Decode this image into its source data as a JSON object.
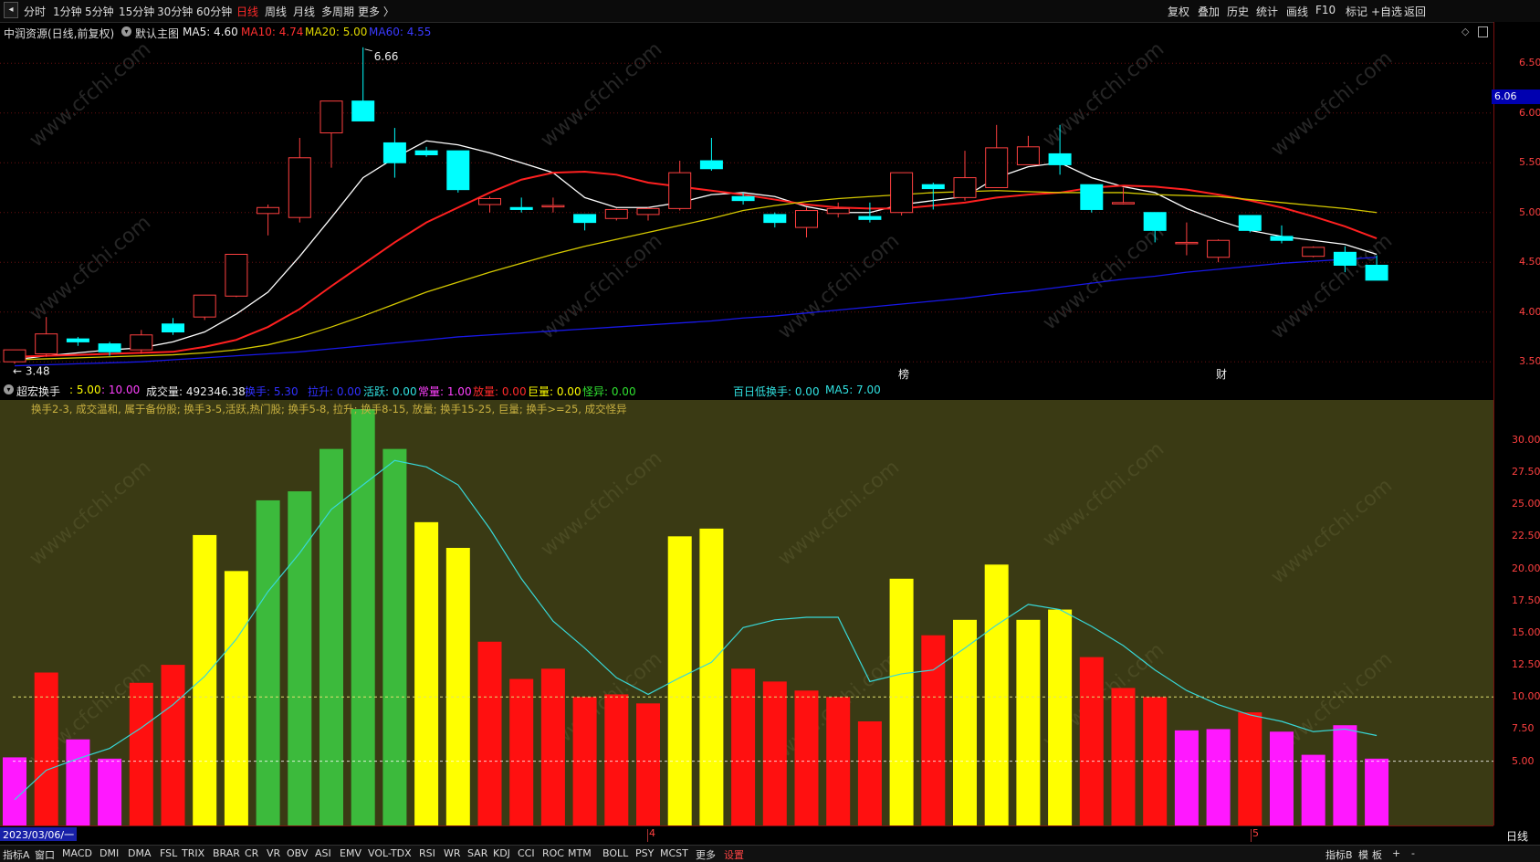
{
  "toolbar": {
    "nav_back_icon": "arrow-left-icon",
    "periods": [
      "分时",
      "1分钟",
      "5分钟",
      "15分钟",
      "30分钟",
      "60分钟",
      "日线",
      "周线",
      "月线",
      "多周期",
      "更多 〉"
    ],
    "active_period": "日线",
    "right_items": [
      "复权",
      "叠加",
      "历史",
      "统计",
      "画线",
      "F10",
      "标记",
      "+自选",
      "返回"
    ]
  },
  "main_chart": {
    "stock_title": "中润资源(日线,前复权)",
    "indicator_name": "默认主图",
    "ma5": "MA5: 4.60",
    "ma10": "MA10: 4.74",
    "ma20": "MA20: 5.00",
    "ma60": "MA60: 4.55",
    "high_label": "6.66",
    "low_label": "3.48",
    "price_tag": "6.06",
    "event_markers": [
      "榜",
      "财"
    ],
    "y_ticks": [
      "6.50",
      "6.00",
      "5.50",
      "5.00",
      "4.50",
      "4.00",
      "3.50"
    ]
  },
  "sub_chart": {
    "name": "超宏换手",
    "v1": ": 5.00",
    "v2": ": 10.00",
    "volume": "成交量: 492346.38",
    "l_huanshou": "换手: 5.30",
    "l_lasheng": "拉升: 0.00",
    "l_huoyue": "活跃: 0.00",
    "l_changliang": "常量: 1.00",
    "l_fangliang": "放量: 0.00",
    "l_juliang": "巨量: 0.00",
    "l_guaiyi": "怪异: 0.00",
    "l_dihuan": "百日低换手: 0.00",
    "l_ma5": "MA5: 7.00",
    "note": "换手2-3, 成交温和, 属于备份股; 换手3-5,活跃,热门股; 换手5-8, 拉升; 换手8-15, 放量; 换手15-25, 巨量; 换手>=25, 成交怪异",
    "y_ticks": [
      "30.00",
      "27.50",
      "25.00",
      "22.50",
      "20.00",
      "17.50",
      "15.00",
      "12.50",
      "10.00",
      "7.50",
      "5.00"
    ]
  },
  "x_axis": {
    "start_date": "2023/03/06/一",
    "month_labels": [
      "4",
      "5"
    ],
    "period_label": "日线"
  },
  "bottom_tabs": {
    "left": [
      "指标A",
      "窗口",
      "MACD",
      "DMI",
      "DMA",
      "FSL",
      "TRIX",
      "BRAR",
      "CR",
      "VR",
      "OBV",
      "ASI",
      "EMV",
      "VOL-TDX",
      "RSI",
      "WR",
      "SAR",
      "KDJ",
      "CCI",
      "ROC",
      "MTM",
      "BOLL",
      "PSY",
      "MCST",
      "更多",
      "设置"
    ],
    "right": [
      "指标B",
      "模",
      "板",
      "+",
      "-"
    ]
  },
  "watermark": "www.cfchi.com",
  "chart_data": [
    {
      "type": "candlestick",
      "title": "中润资源(日线,前复权)",
      "ylim": [
        3.3,
        6.75
      ],
      "candles": [
        {
          "o": 3.5,
          "c": 3.62,
          "h": 3.62,
          "l": 3.48
        },
        {
          "o": 3.58,
          "c": 3.78,
          "h": 3.95,
          "l": 3.55
        },
        {
          "o": 3.73,
          "c": 3.7,
          "h": 3.75,
          "l": 3.66
        },
        {
          "o": 3.68,
          "c": 3.6,
          "h": 3.7,
          "l": 3.56
        },
        {
          "o": 3.62,
          "c": 3.77,
          "h": 3.82,
          "l": 3.58
        },
        {
          "o": 3.88,
          "c": 3.8,
          "h": 3.94,
          "l": 3.77
        },
        {
          "o": 3.95,
          "c": 4.17,
          "h": 4.17,
          "l": 3.92
        },
        {
          "o": 4.16,
          "c": 4.58,
          "h": 4.58,
          "l": 4.15
        },
        {
          "o": 4.99,
          "c": 5.05,
          "h": 5.08,
          "l": 4.77
        },
        {
          "o": 4.95,
          "c": 5.55,
          "h": 5.75,
          "l": 4.9
        },
        {
          "o": 5.8,
          "c": 6.12,
          "h": 6.12,
          "l": 5.45
        },
        {
          "o": 6.12,
          "c": 5.92,
          "h": 6.66,
          "l": 5.92
        },
        {
          "o": 5.7,
          "c": 5.5,
          "h": 5.85,
          "l": 5.35
        },
        {
          "o": 5.62,
          "c": 5.58,
          "h": 5.66,
          "l": 5.56
        },
        {
          "o": 5.62,
          "c": 5.23,
          "h": 5.62,
          "l": 5.2
        },
        {
          "o": 5.08,
          "c": 5.14,
          "h": 5.16,
          "l": 5.0
        },
        {
          "o": 5.05,
          "c": 5.03,
          "h": 5.15,
          "l": 5.0
        },
        {
          "o": 5.07,
          "c": 5.07,
          "h": 5.15,
          "l": 5.0
        },
        {
          "o": 4.98,
          "c": 4.9,
          "h": 4.98,
          "l": 4.82
        },
        {
          "o": 4.94,
          "c": 5.03,
          "h": 5.04,
          "l": 4.92
        },
        {
          "o": 4.98,
          "c": 5.04,
          "h": 5.05,
          "l": 4.92
        },
        {
          "o": 5.04,
          "c": 5.4,
          "h": 5.52,
          "l": 5.02
        },
        {
          "o": 5.52,
          "c": 5.44,
          "h": 5.75,
          "l": 5.42
        },
        {
          "o": 5.16,
          "c": 5.12,
          "h": 5.2,
          "l": 5.08
        },
        {
          "o": 4.98,
          "c": 4.9,
          "h": 5.0,
          "l": 4.85
        },
        {
          "o": 4.85,
          "c": 5.02,
          "h": 5.05,
          "l": 4.75
        },
        {
          "o": 4.99,
          "c": 5.04,
          "h": 5.1,
          "l": 4.95
        },
        {
          "o": 4.96,
          "c": 4.93,
          "h": 5.1,
          "l": 4.9
        },
        {
          "o": 5.0,
          "c": 5.4,
          "h": 5.4,
          "l": 4.97
        },
        {
          "o": 5.28,
          "c": 5.24,
          "h": 5.3,
          "l": 5.03
        },
        {
          "o": 5.15,
          "c": 5.35,
          "h": 5.62,
          "l": 5.12
        },
        {
          "o": 5.25,
          "c": 5.65,
          "h": 5.88,
          "l": 5.25
        },
        {
          "o": 5.48,
          "c": 5.66,
          "h": 5.77,
          "l": 5.48
        },
        {
          "o": 5.59,
          "c": 5.48,
          "h": 5.88,
          "l": 5.38
        },
        {
          "o": 5.28,
          "c": 5.03,
          "h": 5.28,
          "l": 5.0
        },
        {
          "o": 5.1,
          "c": 5.1,
          "h": 5.25,
          "l": 5.08
        },
        {
          "o": 5.0,
          "c": 4.82,
          "h": 5.0,
          "l": 4.7
        },
        {
          "o": 4.7,
          "c": 4.7,
          "h": 4.9,
          "l": 4.57
        },
        {
          "o": 4.55,
          "c": 4.72,
          "h": 4.73,
          "l": 4.5
        },
        {
          "o": 4.97,
          "c": 4.82,
          "h": 4.97,
          "l": 4.8
        },
        {
          "o": 4.76,
          "c": 4.72,
          "h": 4.87,
          "l": 4.69
        },
        {
          "o": 4.56,
          "c": 4.65,
          "h": 4.66,
          "l": 4.55
        },
        {
          "o": 4.6,
          "c": 4.47,
          "h": 4.66,
          "l": 4.4
        },
        {
          "o": 4.47,
          "c": 4.32,
          "h": 4.57,
          "l": 4.32
        }
      ],
      "series": [
        {
          "name": "MA5",
          "color": "#ffffff",
          "values": [
            3.52,
            3.56,
            3.59,
            3.62,
            3.64,
            3.7,
            3.8,
            3.98,
            4.2,
            4.56,
            4.95,
            5.35,
            5.55,
            5.72,
            5.68,
            5.6,
            5.5,
            5.4,
            5.15,
            5.05,
            5.05,
            5.1,
            5.18,
            5.2,
            5.16,
            5.06,
            5.0,
            5.0,
            5.08,
            5.12,
            5.16,
            5.35,
            5.46,
            5.5,
            5.35,
            5.26,
            5.2,
            5.04,
            4.92,
            4.82,
            4.76,
            4.72,
            4.68,
            4.58
          ]
        },
        {
          "name": "MA10",
          "color": "#ff2020",
          "values": [
            3.55,
            3.56,
            3.57,
            3.58,
            3.59,
            3.6,
            3.65,
            3.72,
            3.85,
            4.03,
            4.26,
            4.48,
            4.7,
            4.9,
            5.05,
            5.2,
            5.33,
            5.4,
            5.41,
            5.38,
            5.3,
            5.26,
            5.22,
            5.18,
            5.13,
            5.08,
            5.05,
            5.04,
            5.04,
            5.07,
            5.1,
            5.15,
            5.18,
            5.2,
            5.25,
            5.27,
            5.26,
            5.23,
            5.18,
            5.12,
            5.05,
            4.96,
            4.86,
            4.74
          ]
        },
        {
          "name": "MA20",
          "color": "#d4c800",
          "values": [
            3.52,
            3.53,
            3.54,
            3.55,
            3.56,
            3.57,
            3.59,
            3.62,
            3.67,
            3.75,
            3.85,
            3.96,
            4.08,
            4.2,
            4.3,
            4.4,
            4.49,
            4.58,
            4.66,
            4.73,
            4.8,
            4.87,
            4.94,
            5.02,
            5.07,
            5.11,
            5.14,
            5.16,
            5.18,
            5.2,
            5.21,
            5.22,
            5.21,
            5.2,
            5.2,
            5.2,
            5.18,
            5.17,
            5.16,
            5.13,
            5.1,
            5.07,
            5.04,
            5.0
          ]
        },
        {
          "name": "MA60",
          "color": "#1818e8",
          "values": [
            3.46,
            3.47,
            3.48,
            3.49,
            3.5,
            3.52,
            3.54,
            3.56,
            3.58,
            3.6,
            3.63,
            3.66,
            3.69,
            3.72,
            3.75,
            3.77,
            3.79,
            3.81,
            3.83,
            3.85,
            3.87,
            3.89,
            3.91,
            3.94,
            3.96,
            3.99,
            4.02,
            4.05,
            4.08,
            4.11,
            4.14,
            4.18,
            4.21,
            4.25,
            4.29,
            4.33,
            4.36,
            4.4,
            4.43,
            4.46,
            4.49,
            4.51,
            4.53,
            4.55
          ]
        }
      ]
    },
    {
      "type": "bar",
      "title": "超宏换手",
      "ylim": [
        0,
        32.4
      ],
      "values": [
        5.3,
        11.9,
        6.7,
        5.2,
        11.1,
        12.5,
        22.6,
        19.8,
        25.3,
        26.0,
        29.3,
        32.4,
        29.3,
        23.6,
        21.6,
        14.3,
        11.4,
        12.2,
        10.0,
        10.2,
        9.5,
        22.5,
        23.1,
        12.2,
        11.2,
        10.5,
        10.0,
        8.1,
        19.2,
        14.8,
        16.0,
        20.3,
        16.0,
        16.8,
        13.1,
        10.7,
        10.0,
        7.4,
        7.5,
        8.8,
        7.3,
        5.5,
        7.8,
        5.2
      ],
      "bar_colors": [
        "#ff18ff",
        "#ff1010",
        "#ff18ff",
        "#ff18ff",
        "#ff1010",
        "#ff1010",
        "#ffff00",
        "#ffff00",
        "#3cba3c",
        "#3cba3c",
        "#3cba3c",
        "#3cba3c",
        "#3cba3c",
        "#ffff00",
        "#ffff00",
        "#ff1010",
        "#ff1010",
        "#ff1010",
        "#ff1010",
        "#ff1010",
        "#ff1010",
        "#ffff00",
        "#ffff00",
        "#ff1010",
        "#ff1010",
        "#ff1010",
        "#ff1010",
        "#ff1010",
        "#ffff00",
        "#ff1010",
        "#ffff00",
        "#ffff00",
        "#ffff00",
        "#ffff00",
        "#ff1010",
        "#ff1010",
        "#ff1010",
        "#ff18ff",
        "#ff18ff",
        "#ff1010",
        "#ff18ff",
        "#ff18ff",
        "#ff18ff",
        "#ff18ff"
      ],
      "ma_line": {
        "name": "MA5",
        "color": "#38d8d8",
        "values": [
          2.0,
          4.3,
          5.2,
          6.0,
          7.6,
          9.4,
          11.6,
          14.5,
          18.2,
          21.2,
          24.6,
          26.5,
          28.4,
          27.9,
          26.5,
          23.1,
          19.2,
          15.9,
          13.8,
          11.5,
          10.2,
          11.5,
          12.7,
          15.4,
          16.0,
          16.2,
          16.2,
          11.2,
          11.8,
          12.1,
          13.8,
          15.6,
          17.2,
          16.8,
          15.5,
          14.0,
          12.1,
          10.5,
          9.4,
          8.6,
          8.1,
          7.3,
          7.5,
          7.0
        ]
      },
      "reference_lines": [
        5.0,
        10.0
      ]
    }
  ]
}
